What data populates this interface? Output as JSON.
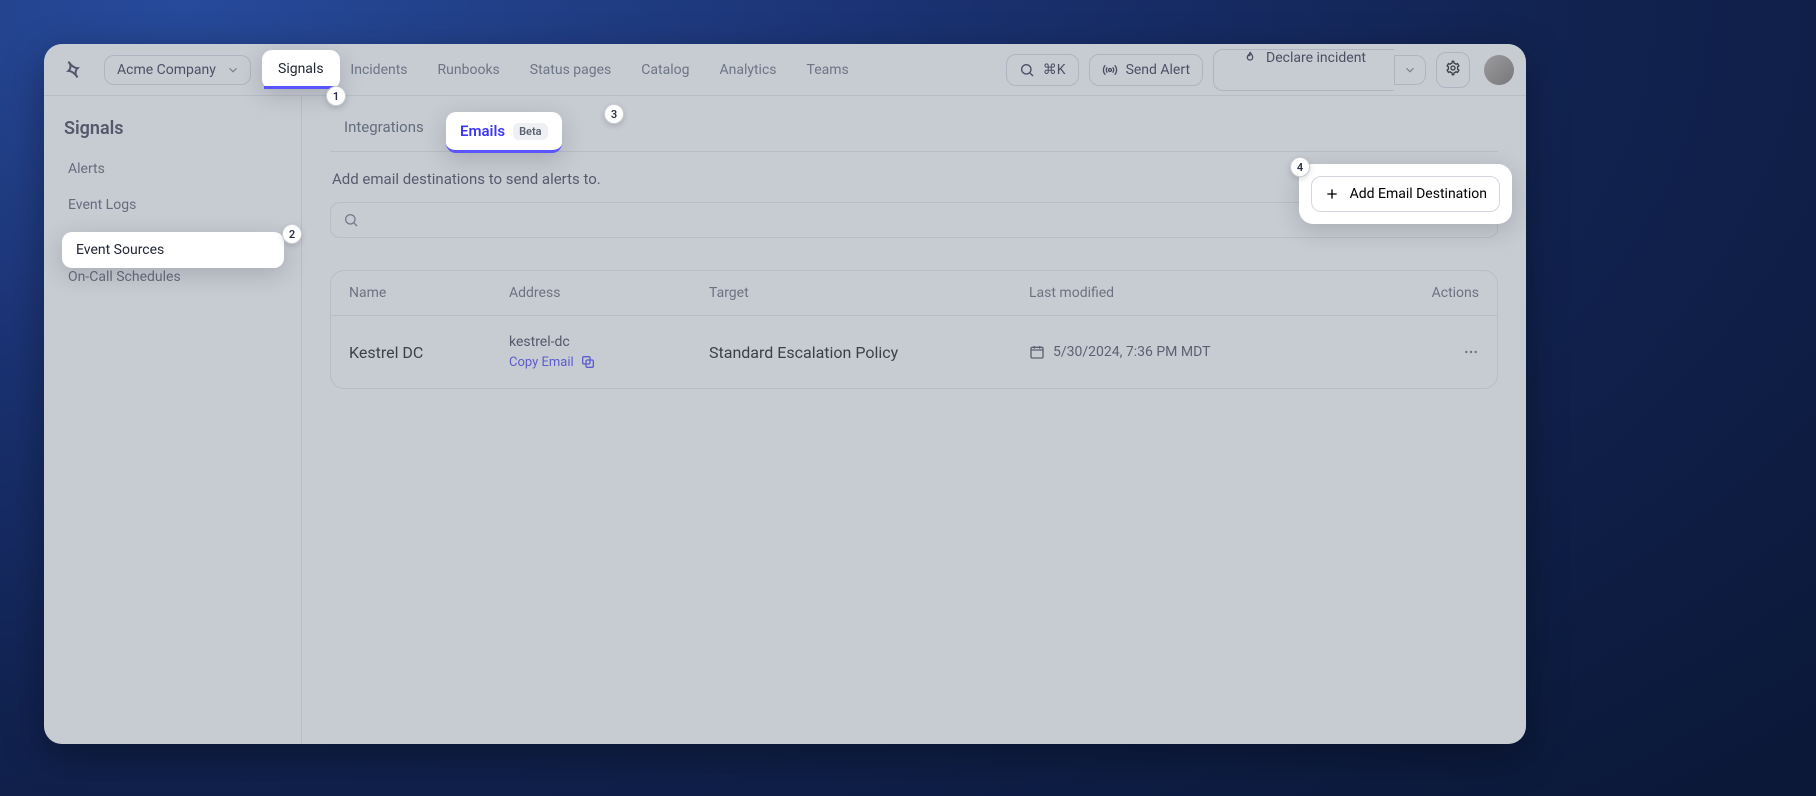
{
  "header": {
    "company": "Acme Company",
    "nav": [
      "Signals",
      "Incidents",
      "Runbooks",
      "Status pages",
      "Catalog",
      "Analytics",
      "Teams"
    ],
    "active_nav_index": 0,
    "search_shortcut": "⌘K",
    "send_alert": "Send Alert",
    "declare": "Declare incident"
  },
  "sidebar": {
    "title": "Signals",
    "items": [
      "Alerts",
      "Event Logs",
      "Event Sources",
      "On-Call Schedules"
    ],
    "active_index": 2
  },
  "tabs": {
    "items": [
      {
        "label": "Integrations"
      },
      {
        "label": "Emails",
        "badge": "Beta"
      }
    ],
    "active_index": 1
  },
  "page": {
    "subheading": "Add email destinations to send alerts to.",
    "add_button": "Add Email Destination",
    "search_placeholder": ""
  },
  "table": {
    "columns": [
      "Name",
      "Address",
      "Target",
      "Last modified",
      "Actions"
    ],
    "rows": [
      {
        "name": "Kestrel DC",
        "address": "kestrel-dc",
        "copy_label": "Copy Email",
        "target": "Standard Escalation Policy",
        "last_modified": "5/30/2024, 7:36 PM MDT"
      }
    ]
  },
  "tour": {
    "steps": [
      "1",
      "2",
      "3",
      "4"
    ]
  }
}
